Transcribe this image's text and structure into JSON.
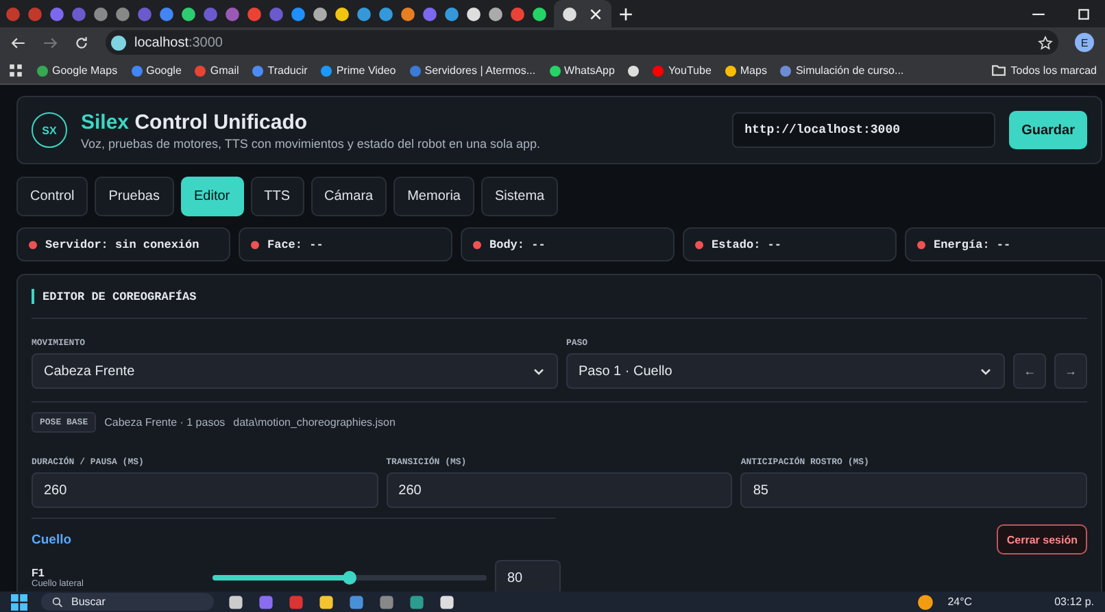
{
  "browser": {
    "address": {
      "host": "localhost",
      "port": ":3000"
    },
    "profile": "E",
    "bookmarks": [
      {
        "label": "Google Maps",
        "color": "#34a853"
      },
      {
        "label": "Google",
        "color": "#4285f4"
      },
      {
        "label": "Gmail",
        "color": "#ea4335"
      },
      {
        "label": "Traducir",
        "color": "#4c8bf5"
      },
      {
        "label": "Prime Video",
        "color": "#1a98ff"
      },
      {
        "label": "Servidores | Atermos...",
        "color": "#3a7bd5"
      },
      {
        "label": "WhatsApp",
        "color": "#25d366"
      },
      {
        "color": "#dddddd"
      },
      {
        "label": "YouTube",
        "color": "#ff0000"
      },
      {
        "label": "Maps",
        "color": "#fbbc04"
      },
      {
        "label": "Simulación de curso...",
        "color": "#6c8cd5"
      }
    ],
    "other_bookmarks": "Todos los marcad"
  },
  "header": {
    "logo": "SX",
    "brand": "Silex",
    "title": "Control Unificado",
    "subtitle": "Voz, pruebas de motores, TTS con movimientos y estado del robot en una sola app.",
    "server_url": "http://localhost:3000",
    "save": "Guardar"
  },
  "tabs": [
    {
      "label": "Control",
      "selected": false
    },
    {
      "label": "Pruebas",
      "selected": false
    },
    {
      "label": "Editor",
      "selected": true
    },
    {
      "label": "TTS",
      "selected": false
    },
    {
      "label": "Cámara",
      "selected": false
    },
    {
      "label": "Memoria",
      "selected": false
    },
    {
      "label": "Sistema",
      "selected": false
    }
  ],
  "status": [
    {
      "label": "Servidor: sin conexión",
      "color": "#f05252"
    },
    {
      "label": "Face: --",
      "color": "#f05252"
    },
    {
      "label": "Body: --",
      "color": "#f05252"
    },
    {
      "label": "Estado: --",
      "color": "#f05252"
    },
    {
      "label": "Energía: --",
      "color": "#f05252"
    }
  ],
  "editor": {
    "title": "EDITOR DE COREOGRAFÍAS",
    "movement_label": "MOVIMIENTO",
    "movement": "Cabeza Frente",
    "step_label": "PASO",
    "step": "Paso 1 · Cuello",
    "prev": "←",
    "next": "→",
    "badge": "POSE BASE",
    "summary": "Cabeza Frente · 1 pasos",
    "file": "data\\motion_choreographies.json",
    "fields": [
      {
        "label": "DURACIÓN / PAUSA (MS)",
        "value": "260"
      },
      {
        "label": "TRANSICIÓN (MS)",
        "value": "260"
      },
      {
        "label": "ANTICIPACIÓN ROSTRO (MS)",
        "value": "85"
      }
    ],
    "group": "Cuello",
    "logout": "Cerrar sesión",
    "motors": [
      {
        "name": "F1",
        "description": "Cuello lateral",
        "level": 0.5,
        "value": "80"
      }
    ]
  },
  "taskbar": {
    "search": "Buscar",
    "weather": "24°C",
    "clock": "03:12 p."
  }
}
